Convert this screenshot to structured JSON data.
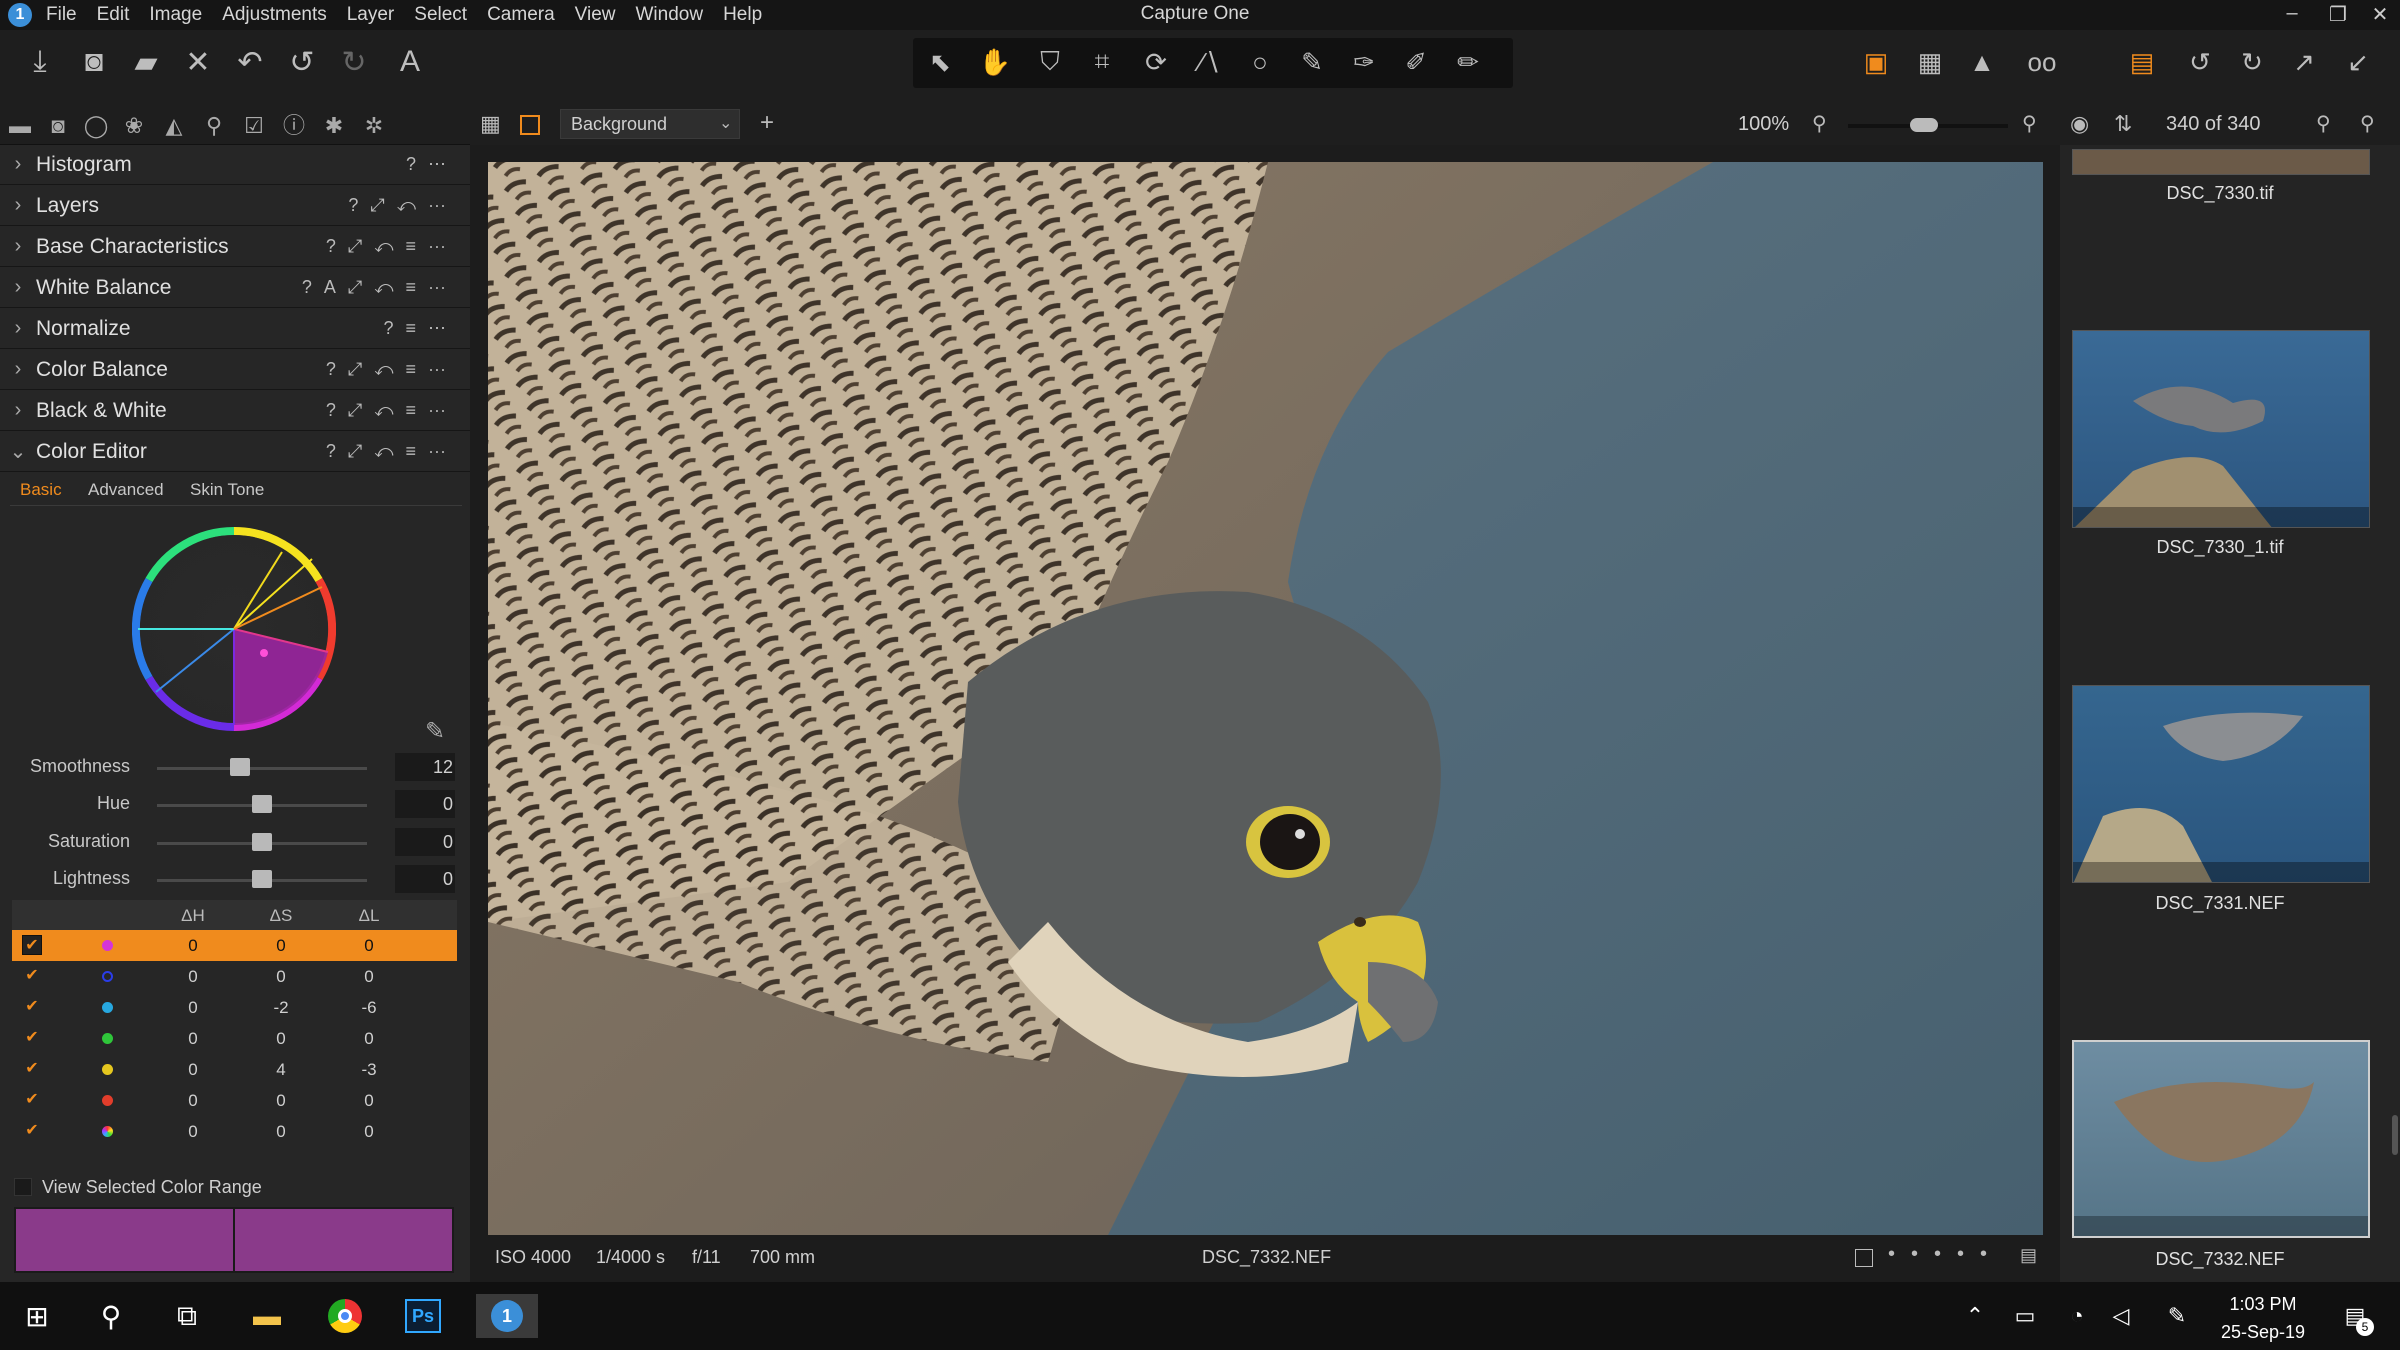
{
  "app": {
    "title": "Capture One"
  },
  "menu": [
    "File",
    "Edit",
    "Image",
    "Adjustments",
    "Layer",
    "Select",
    "Camera",
    "View",
    "Window",
    "Help"
  ],
  "window_controls": {
    "minimize": "–",
    "maximize": "❐",
    "close": "✕"
  },
  "viewer_bar": {
    "layer_select": "Background",
    "zoom": "100%",
    "count": "340 of 340"
  },
  "tools": [
    {
      "name": "Histogram",
      "expanded": false
    },
    {
      "name": "Layers",
      "expanded": false
    },
    {
      "name": "Base Characteristics",
      "expanded": false
    },
    {
      "name": "White Balance",
      "expanded": false
    },
    {
      "name": "Normalize",
      "expanded": false
    },
    {
      "name": "Color Balance",
      "expanded": false
    },
    {
      "name": "Black & White",
      "expanded": false
    },
    {
      "name": "Color Editor",
      "expanded": true
    }
  ],
  "color_editor": {
    "tabs": [
      "Basic",
      "Advanced",
      "Skin Tone"
    ],
    "active_tab": "Basic",
    "sliders": [
      {
        "label": "Smoothness",
        "value": "12",
        "position": 0.45
      },
      {
        "label": "Hue",
        "value": "0",
        "position": 0.5
      },
      {
        "label": "Saturation",
        "value": "0",
        "position": 0.5
      },
      {
        "label": "Lightness",
        "value": "0",
        "position": 0.5
      }
    ],
    "table_headers": [
      "ΔH",
      "ΔS",
      "ΔL"
    ],
    "rows": [
      {
        "color": "#d534d8",
        "dh": "0",
        "ds": "0",
        "dl": "0",
        "selected": true
      },
      {
        "color": "#2a3de8",
        "dh": "0",
        "ds": "0",
        "dl": "0",
        "selected": false
      },
      {
        "color": "#27a8e0",
        "dh": "0",
        "ds": "-2",
        "dl": "-6",
        "selected": false
      },
      {
        "color": "#2fc63a",
        "dh": "0",
        "ds": "0",
        "dl": "0",
        "selected": false
      },
      {
        "color": "#e5c71f",
        "dh": "0",
        "ds": "4",
        "dl": "-3",
        "selected": false
      },
      {
        "color": "#e23d2b",
        "dh": "0",
        "ds": "0",
        "dl": "0",
        "selected": false
      },
      {
        "color": "multicolor",
        "dh": "0",
        "ds": "0",
        "dl": "0",
        "selected": false
      }
    ],
    "view_selected_label": "View Selected Color Range",
    "swatch_color": "#8a3a8a"
  },
  "photo_info": {
    "iso": "ISO 4000",
    "shutter": "1/4000 s",
    "aperture": "f/11",
    "focal": "700 mm",
    "filename": "DSC_7332.NEF"
  },
  "browser": [
    {
      "name": "DSC_7330.tif"
    },
    {
      "name": "DSC_7330_1.tif"
    },
    {
      "name": "DSC_7331.NEF"
    },
    {
      "name": "DSC_7332.NEF"
    }
  ],
  "taskbar": {
    "time": "1:03 PM",
    "date": "25-Sep-19",
    "notifications": "5"
  },
  "accent": "#f08b1d"
}
